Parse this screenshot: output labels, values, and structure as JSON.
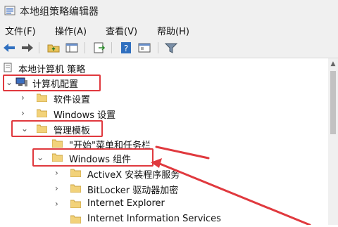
{
  "window": {
    "title": "本地组策略编辑器"
  },
  "menu": [
    {
      "label": "文件(F)"
    },
    {
      "label": "操作(A)"
    },
    {
      "label": "查看(V)"
    },
    {
      "label": "帮助(H)"
    }
  ],
  "toolbar_icons": [
    "back-arrow-icon",
    "forward-arrow-icon",
    "folder-up-icon",
    "show-hide-tree-icon",
    "export-list-icon",
    "help-icon",
    "properties-icon",
    "filter-icon"
  ],
  "tree": {
    "root": {
      "label": "本地计算机 策略"
    },
    "computer_config": {
      "label": "计算机配置",
      "expanded": true
    },
    "software_settings": {
      "label": "软件设置"
    },
    "windows_settings": {
      "label": "Windows 设置"
    },
    "admin_templates": {
      "label": "管理模板",
      "expanded": true
    },
    "start_menu": {
      "label": "\"开始\"菜单和任务栏"
    },
    "windows_components": {
      "label": "Windows 组件",
      "expanded": true
    },
    "activex": {
      "label": "ActiveX 安装程序服务"
    },
    "bitlocker": {
      "label": "BitLocker 驱动器加密"
    },
    "ie": {
      "label": "Internet Explorer"
    },
    "iis": {
      "label": "Internet Information Services"
    }
  },
  "colors": {
    "highlight": "#e0393e",
    "folder": "#e8c35a"
  }
}
